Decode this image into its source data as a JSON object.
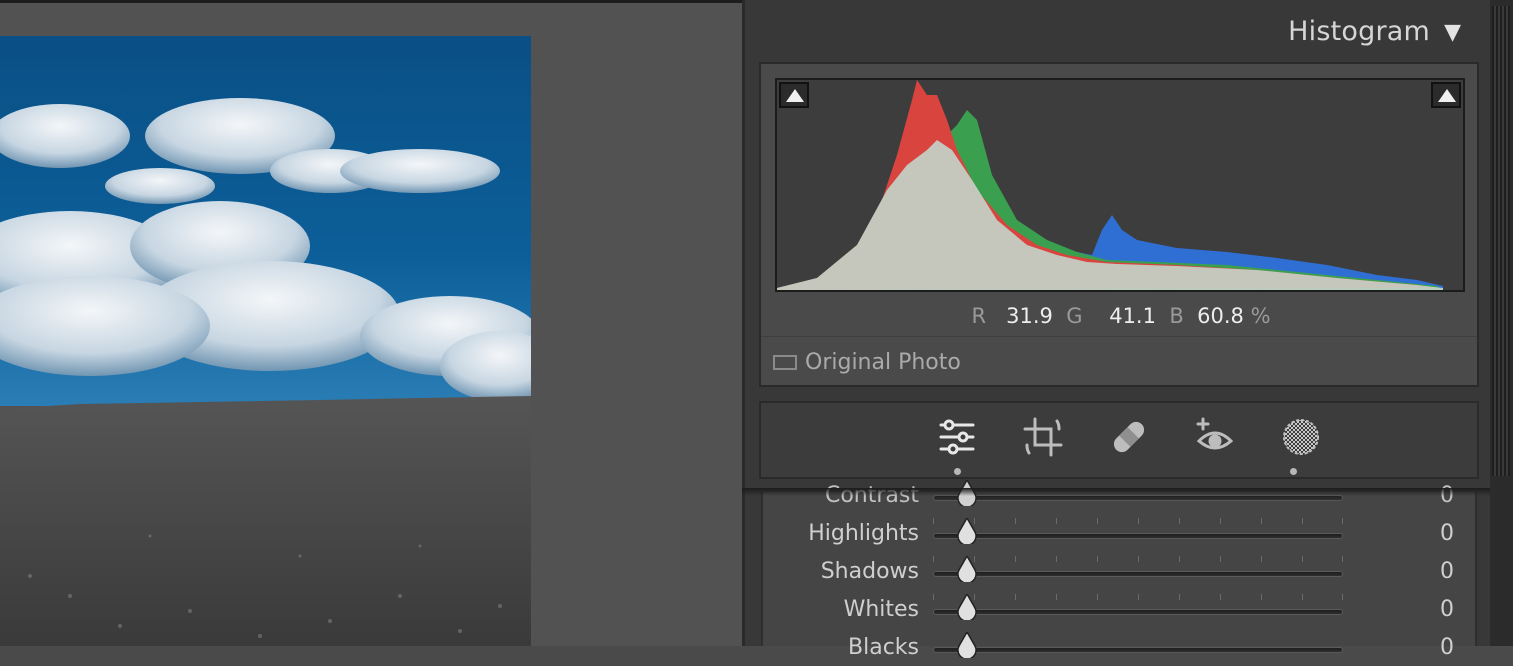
{
  "histogram": {
    "title": "Histogram",
    "toggle_icon": "disclosure-triangle-down",
    "readout": {
      "r_label": "R",
      "r_value": "31.9",
      "g_label": "G",
      "g_value": "41.1",
      "b_label": "B",
      "b_value": "60.8",
      "unit": "%"
    },
    "original_photo_label": "Original Photo",
    "colors": {
      "red": "#d9443f",
      "green": "#3aa04f",
      "blue": "#2f6fd4",
      "luminance": "#c3d3c8"
    }
  },
  "tool_strip": {
    "tools": [
      {
        "icon": "edit-sliders-icon",
        "active": true
      },
      {
        "icon": "crop-icon",
        "active": false
      },
      {
        "icon": "healing-bandage-icon",
        "active": false
      },
      {
        "icon": "red-eye-icon",
        "active": false
      },
      {
        "icon": "masking-icon",
        "active": false
      }
    ]
  },
  "basic_panel": {
    "sliders": [
      {
        "label": "Contrast",
        "value": "0"
      },
      {
        "label": "Highlights",
        "value": "0"
      },
      {
        "label": "Shadows",
        "value": "0"
      },
      {
        "label": "Whites",
        "value": "0"
      },
      {
        "label": "Blacks",
        "value": "0"
      }
    ]
  }
}
